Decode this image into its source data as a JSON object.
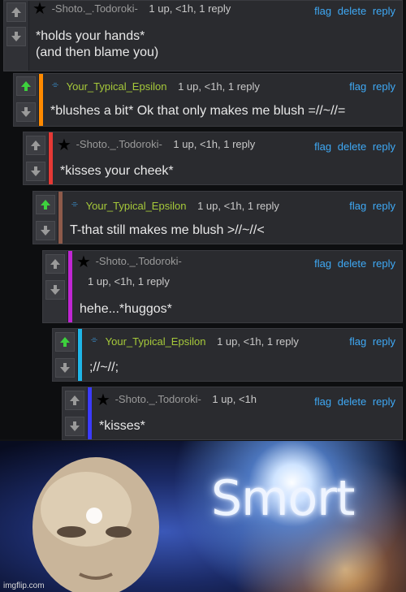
{
  "comments": [
    {
      "username": "-Shoto._.Todoroki-",
      "meta": "1 up, <1h, 1 reply",
      "flag": "flag",
      "delete": "delete",
      "reply": "reply",
      "body": "*holds your hands*\n(and then blame you)",
      "bar_color": "",
      "upvoted": false
    },
    {
      "username": "Your_Typical_Epsilon",
      "meta": "1 up, <1h, 1 reply",
      "flag": "flag",
      "reply": "reply",
      "body": "*blushes a bit* Ok that only makes me blush =//~//=",
      "bar_color": "#ff8a00",
      "upvoted": true
    },
    {
      "username": "-Shoto._.Todoroki-",
      "meta": "1 up, <1h, 1 reply",
      "flag": "flag",
      "delete": "delete",
      "reply": "reply",
      "body": "*kisses your cheek*",
      "bar_color": "#e53935",
      "upvoted": false
    },
    {
      "username": "Your_Typical_Epsilon",
      "meta": "1 up, <1h, 1 reply",
      "flag": "flag",
      "reply": "reply",
      "body": "T-that still makes me blush >//~//<",
      "bar_color": "#8d5a4a",
      "upvoted": true
    },
    {
      "username": "-Shoto._.Todoroki-",
      "meta": "1 up, <1h, 1 reply",
      "flag": "flag",
      "delete": "delete",
      "reply": "reply",
      "body": "hehe...*huggos*",
      "bar_color": "#c026d3",
      "upvoted": false
    },
    {
      "username": "Your_Typical_Epsilon",
      "meta": "1 up, <1h, 1 reply",
      "flag": "flag",
      "reply": "reply",
      "body": ";//~//;",
      "bar_color": "#1fb6e8",
      "upvoted": true
    },
    {
      "username": "-Shoto._.Todoroki-",
      "meta": "1 up, <1h",
      "flag": "flag",
      "delete": "delete",
      "reply": "reply",
      "body": "*kisses*",
      "bar_color": "#3b3bff",
      "upvoted": false
    }
  ],
  "meme": {
    "caption": "Smort",
    "watermark": "imgflip.com"
  },
  "icons": {
    "upvote": "arrow-up-icon",
    "downvote": "arrow-down-icon",
    "shoto_avatar": "star-icon",
    "epsilon_avatar": "epsilon-icon"
  }
}
